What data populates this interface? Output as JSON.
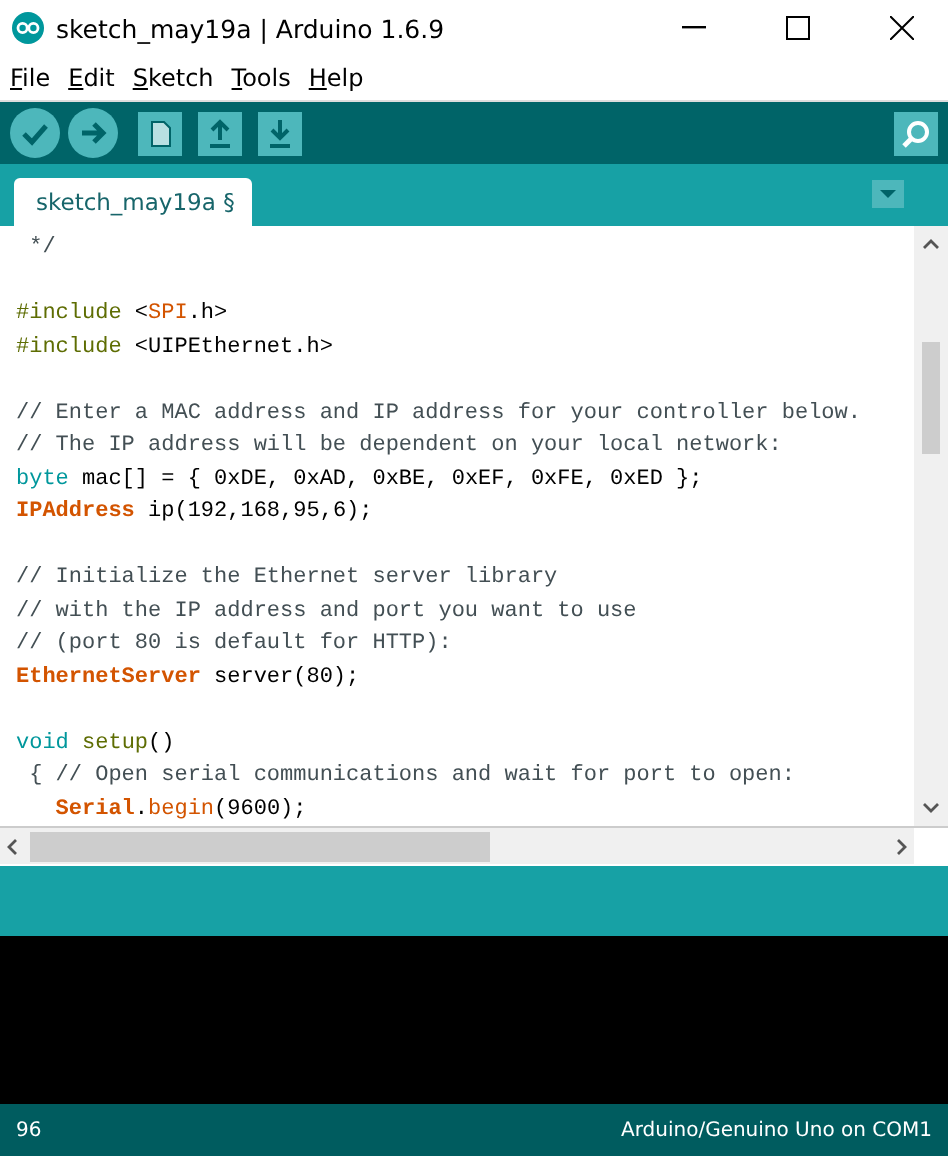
{
  "window": {
    "title": "sketch_may19a | Arduino 1.6.9"
  },
  "menu": [
    "File",
    "Edit",
    "Sketch",
    "Tools",
    "Help"
  ],
  "tabs": [
    {
      "label": "sketch_may19a §",
      "selected": true
    }
  ],
  "code": [
    [
      {
        "text": " */",
        "kind": "comment"
      }
    ],
    [
      {
        "kind": "blank"
      }
    ],
    [
      {
        "text": "#include",
        "kind": "preproc"
      },
      {
        "text": " <",
        "kind": "plain"
      },
      {
        "text": "SPI",
        "kind": "type"
      },
      {
        "text": ".h>",
        "kind": "plain"
      }
    ],
    [
      {
        "text": "#include",
        "kind": "preproc"
      },
      {
        "text": " <UIPEthernet.h>",
        "kind": "plain"
      }
    ],
    [
      {
        "kind": "blank"
      }
    ],
    [
      {
        "text": "// Enter a MAC address and IP address for your controller below.",
        "kind": "comment"
      }
    ],
    [
      {
        "text": "// The IP address will be dependent on your local network:",
        "kind": "comment"
      }
    ],
    [
      {
        "text": "byte",
        "kind": "keyword"
      },
      {
        "text": " mac[] = { 0xDE, 0xAD, 0xBE, 0xEF, 0xFE, 0xED };",
        "kind": "plain"
      }
    ],
    [
      {
        "text": "IPAddress",
        "kind": "classname"
      },
      {
        "text": " ip(192,168,95,6);",
        "kind": "plain"
      }
    ],
    [
      {
        "kind": "blank"
      }
    ],
    [
      {
        "text": "// Initialize the Ethernet server library",
        "kind": "comment"
      }
    ],
    [
      {
        "text": "// with the IP address and port you want to use",
        "kind": "comment"
      }
    ],
    [
      {
        "text": "// (port 80 is default for HTTP):",
        "kind": "comment"
      }
    ],
    [
      {
        "text": "EthernetServer",
        "kind": "classname"
      },
      {
        "text": " server(80);",
        "kind": "plain"
      }
    ],
    [
      {
        "kind": "blank"
      }
    ],
    [
      {
        "text": "void ",
        "kind": "keyword"
      },
      {
        "text": "setup",
        "kind": "preproc"
      },
      {
        "text": "()",
        "kind": "plain"
      }
    ],
    [
      {
        "text": " { // Open serial communications and wait for port to open:",
        "kind": "comment"
      }
    ],
    [
      {
        "text": "   Serial",
        "kind": "classname"
      },
      {
        "text": ".",
        "kind": "plain"
      },
      {
        "text": "begin",
        "kind": "type"
      },
      {
        "text": "(9600);",
        "kind": "plain"
      }
    ]
  ],
  "status_bar": {
    "line": "96",
    "board": "Arduino/Genuino Uno on COM1"
  }
}
